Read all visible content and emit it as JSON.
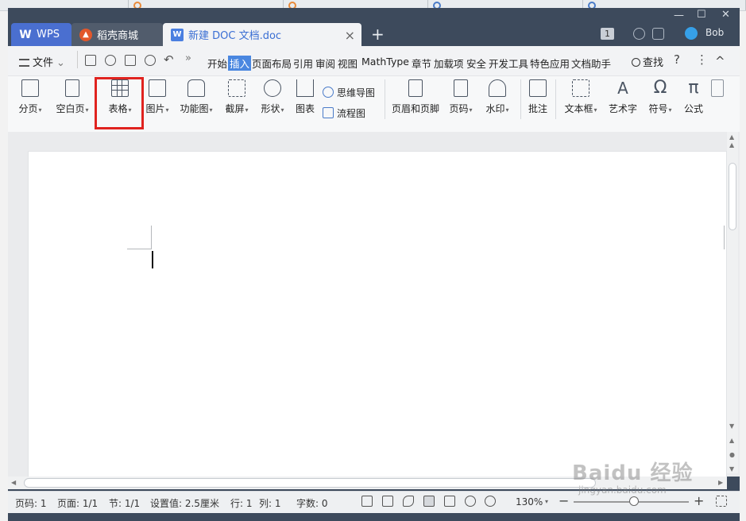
{
  "tabs": {
    "wps": "WPS",
    "shop": "稻壳商城",
    "doc": "新建 DOC 文档.doc",
    "new_tab": "+",
    "close": "×"
  },
  "header": {
    "badge": "1",
    "username": "Bob",
    "window_min": "—",
    "window_max": "☐",
    "window_close": "✕"
  },
  "menubar": {
    "file": "文件",
    "items": [
      "开始",
      "插入",
      "页面布局",
      "引用",
      "审阅",
      "视图",
      "MathType",
      "章节",
      "加载项",
      "安全",
      "开发工具",
      "特色应用",
      "文档助手"
    ],
    "active": "插入",
    "search": "查找",
    "help": "?",
    "more": "⋮",
    "collapse": "^"
  },
  "ribbon": {
    "buttons": [
      {
        "label": "分页",
        "caret": true
      },
      {
        "label": "空白页",
        "caret": true
      },
      {
        "label": "表格",
        "caret": true
      },
      {
        "label": "图片",
        "caret": true
      },
      {
        "label": "功能图",
        "caret": true
      },
      {
        "label": "截屏",
        "caret": true
      },
      {
        "label": "形状",
        "caret": true
      },
      {
        "label": "图表",
        "caret": false
      },
      {
        "label": "页眉和页脚",
        "caret": false
      },
      {
        "label": "页码",
        "caret": true
      },
      {
        "label": "水印",
        "caret": true
      },
      {
        "label": "批注",
        "caret": false
      },
      {
        "label": "文本框",
        "caret": true
      },
      {
        "label": "艺术字",
        "caret": false
      },
      {
        "label": "符号",
        "caret": true
      },
      {
        "label": "公式",
        "caret": false
      }
    ],
    "mindmap": "思维导图",
    "flowchart": "流程图",
    "highlight_color": "#e0231f"
  },
  "statusbar": {
    "page_num": "页码: 1",
    "pages": "页面: 1/1",
    "section": "节: 1/1",
    "setting": "设置值: 2.5厘米",
    "row": "行: 1",
    "col": "列: 1",
    "words": "字数: 0",
    "zoom": "130%",
    "zoom_out": "−",
    "zoom_in": "+"
  },
  "watermark": {
    "brand": "Baidu 经验",
    "url": "jingyan.baidu.com"
  },
  "colors": {
    "titlebar": "#3d4a5c",
    "accent": "#4a87e0"
  }
}
